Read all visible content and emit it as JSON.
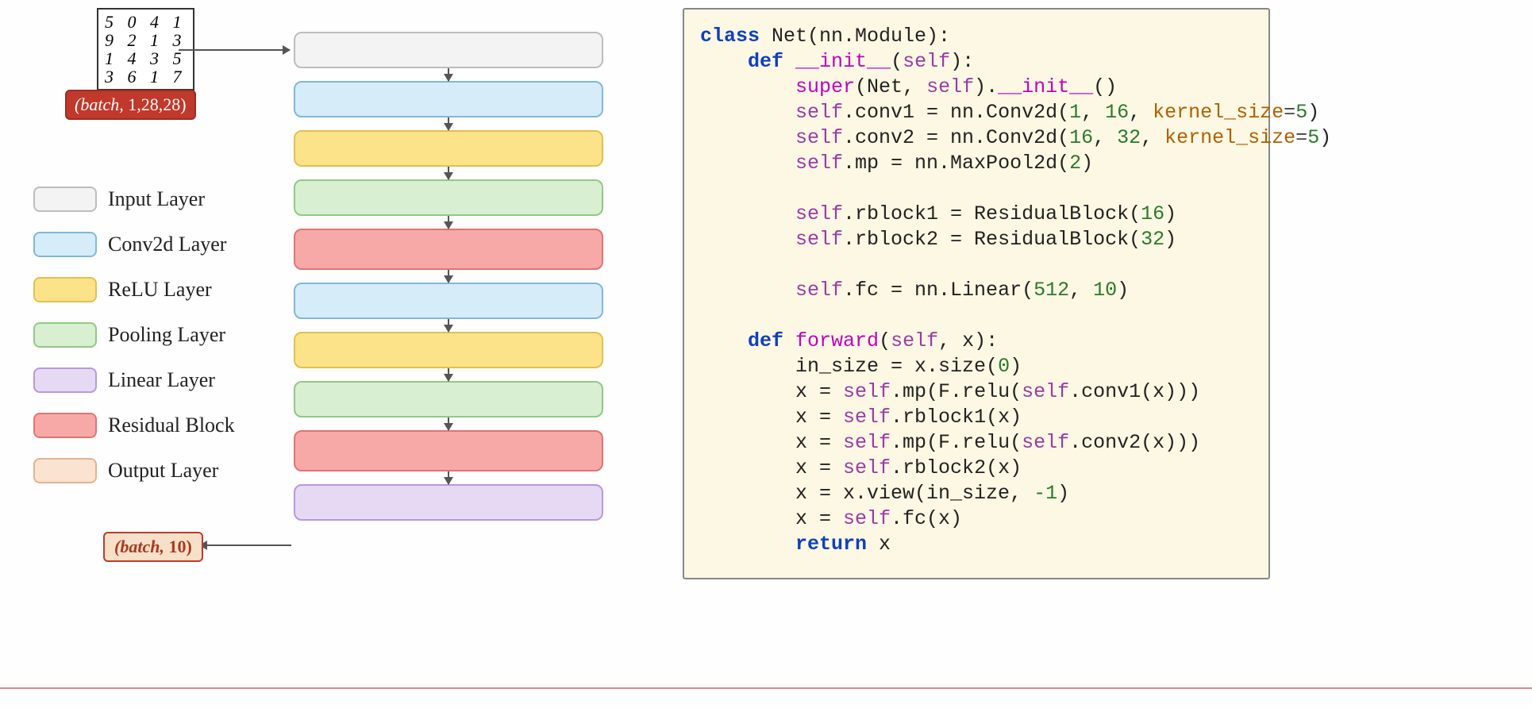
{
  "mnist": [
    "5 0 4 1",
    "9 2 1 3",
    "1 4 3 5",
    "3 6 1 7"
  ],
  "input_shape_prefix": "(batch,",
  "input_shape_rest": " 1,28,28)",
  "output_shape_prefix": "(batch,",
  "output_shape_rest": " 10)",
  "legend": {
    "input": "Input Layer",
    "conv": "Conv2d Layer",
    "relu": "ReLU Layer",
    "pool": "Pooling Layer",
    "linear": "Linear Layer",
    "resid": "Residual Block",
    "output": "Output Layer"
  },
  "colors": {
    "input_bg": "#f3f3f3",
    "conv_bg": "#d6ecf8",
    "relu_bg": "#fce38a",
    "pool_bg": "#d9efd1",
    "linear_bg": "#e6d9f4",
    "resid_bg": "#f7a9a8",
    "output_bg": "#fbe3d2"
  },
  "code": {
    "l1a": "class",
    "l1b": " Net(nn.Module):",
    "l2a": "    def",
    "l2b": " __init__",
    "l2c": "(",
    "l2d": "self",
    "l2e": "):",
    "l3a": "        super",
    "l3b": "(Net, ",
    "l3c": "self",
    "l3d": ").",
    "l3e": "__init__",
    "l3f": "()",
    "l4a": "        self",
    "l4b": ".conv1 = nn.Conv2d(",
    "l4c": "1",
    "l4d": ", ",
    "l4e": "16",
    "l4f": ", ",
    "l4g": "kernel_size",
    "l4h": "=",
    "l4i": "5",
    "l4j": ")",
    "l5a": "        self",
    "l5b": ".conv2 = nn.Conv2d(",
    "l5c": "16",
    "l5d": ", ",
    "l5e": "32",
    "l5f": ", ",
    "l5g": "kernel_size",
    "l5h": "=",
    "l5i": "5",
    "l5j": ")",
    "l6a": "        self",
    "l6b": ".mp = nn.MaxPool2d(",
    "l6c": "2",
    "l6d": ")",
    "blank1": " ",
    "l7a": "        self",
    "l7b": ".rblock1 = ResidualBlock(",
    "l7c": "16",
    "l7d": ")",
    "l8a": "        self",
    "l8b": ".rblock2 = ResidualBlock(",
    "l8c": "32",
    "l8d": ")",
    "blank2": " ",
    "l9a": "        self",
    "l9b": ".fc = nn.Linear(",
    "l9c": "512",
    "l9d": ", ",
    "l9e": "10",
    "l9f": ")",
    "blank3": " ",
    "l10a": "    def",
    "l10b": " forward",
    "l10c": "(",
    "l10d": "self",
    "l10e": ", x):",
    "l11a": "        in_size = x.size(",
    "l11b": "0",
    "l11c": ")",
    "l12a": "        x = ",
    "l12b": "self",
    "l12c": ".mp(F.relu(",
    "l12d": "self",
    "l12e": ".conv1(x)))",
    "l13a": "        x = ",
    "l13b": "self",
    "l13c": ".rblock1(x)",
    "l14a": "        x = ",
    "l14b": "self",
    "l14c": ".mp(F.relu(",
    "l14d": "self",
    "l14e": ".conv2(x)))",
    "l15a": "        x = ",
    "l15b": "self",
    "l15c": ".rblock2(x)",
    "l16a": "        x = x.view(in_size, ",
    "l16b": "-1",
    "l16c": ")",
    "l17a": "        x = ",
    "l17b": "self",
    "l17c": ".fc(x)",
    "l18a": "        return",
    "l18b": " x"
  },
  "flow_layers": [
    "input",
    "conv",
    "relu",
    "pool",
    "resid",
    "conv",
    "relu",
    "pool",
    "resid",
    "linear"
  ]
}
